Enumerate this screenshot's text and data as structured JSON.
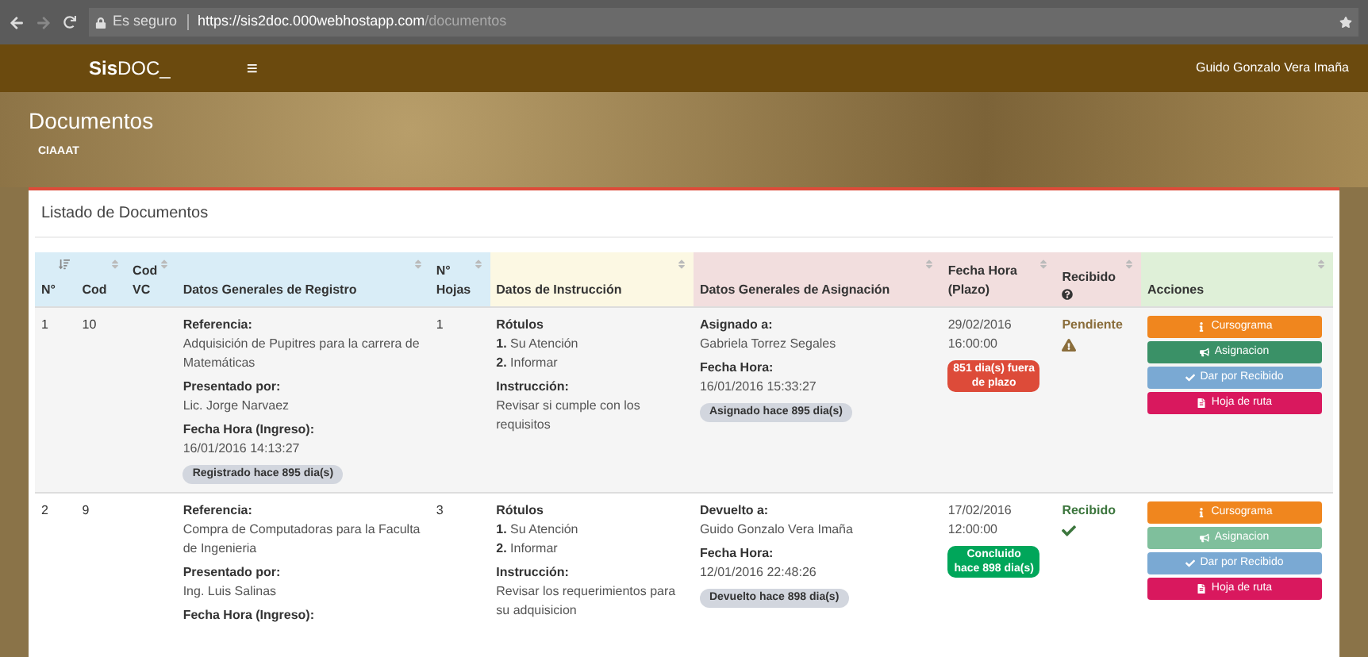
{
  "browser": {
    "security": "Es seguro",
    "url_host": "https://sis2doc.000webhostapp.com",
    "url_path": "/documentos"
  },
  "navbar": {
    "brand_bold": "Sis",
    "brand_rest": "DOC_",
    "menu_icon": "≡",
    "user": "Guido Gonzalo Vera Imaña"
  },
  "header": {
    "title": "Documentos",
    "subtitle": "CIAAAT"
  },
  "panel": {
    "title": "Listado de Documentos"
  },
  "table": {
    "columns": [
      {
        "label": "N°",
        "color": "#d9edf7"
      },
      {
        "label": "Cod",
        "color": "#d9edf7"
      },
      {
        "label": "Cod VC",
        "color": "#d9edf7"
      },
      {
        "label": "Datos Generales de Registro",
        "color": "#d9edf7"
      },
      {
        "label": "N° Hojas",
        "color": "#d9edf7"
      },
      {
        "label": "Datos de Instrucción",
        "color": "#fcf8e3"
      },
      {
        "label": "Datos Generales de Asignación",
        "color": "#f2dede"
      },
      {
        "label": "Fecha Hora (Plazo)",
        "color": "#f2dede"
      },
      {
        "label": "Recibido",
        "color": "#f2dede"
      },
      {
        "label": "Acciones",
        "color": "#dff0d8"
      }
    ],
    "rows": [
      {
        "n": "1",
        "cod": "10",
        "registro": [
          {
            "label": "Referencia:",
            "value": "Adquisición de Pupitres para la carrera de Matemáticas"
          },
          {
            "label": "Presentado por:",
            "value": "Lic. Jorge Narvaez"
          },
          {
            "label": "Fecha Hora (Ingreso):",
            "value": "16/01/2016 14:13:27"
          }
        ],
        "registro_badge": "Registrado hace 895 dia(s)",
        "hojas": "1",
        "rotulos_label": "Rótulos",
        "rotulos": [
          {
            "num": "1.",
            "text": "Su Atención"
          },
          {
            "num": "2.",
            "text": "Informar"
          }
        ],
        "instruccion_label": "Instrucción:",
        "instruccion": "Revisar si cumple con los requisitos",
        "asignacion": [
          {
            "label": "Asignado a:",
            "value": "Gabriela Torrez Segales"
          },
          {
            "label": "Fecha Hora:",
            "value": "16/01/2016 15:33:27"
          }
        ],
        "asignacion_badge": "Asignado hace 895 dia(s)",
        "plazo": [
          "29/02/2016",
          "16:00:00"
        ],
        "plazo_badge": {
          "kind": "late",
          "text": "851 dia(s) fuera de plazo"
        },
        "recibido": {
          "kind": "pending",
          "text": "Pendiente"
        },
        "actions": [
          {
            "kind": "cursograma",
            "text": "Cursograma",
            "disabled": false
          },
          {
            "kind": "asignacion",
            "text": "Asignacion",
            "disabled": false
          },
          {
            "kind": "recibido",
            "text": "Dar por Recibido",
            "disabled": true
          },
          {
            "kind": "hoja",
            "text": "Hoja de ruta",
            "disabled": false
          }
        ]
      },
      {
        "n": "2",
        "cod": "9",
        "registro": [
          {
            "label": "Referencia:",
            "value": "Compra de Computadoras para la Faculta de Ingenieria"
          },
          {
            "label": "Presentado por:",
            "value": "Ing. Luis Salinas"
          },
          {
            "label": "Fecha Hora (Ingreso):"
          }
        ],
        "hojas": "3",
        "rotulos_label": "Rótulos",
        "rotulos": [
          {
            "num": "1.",
            "text": "Su Atención"
          },
          {
            "num": "2.",
            "text": "Informar"
          }
        ],
        "instruccion_label": "Instrucción:",
        "instruccion": "Revisar los requerimientos para su adquisicion",
        "asignacion": [
          {
            "label": "Devuelto a:",
            "value": "Guido Gonzalo Vera Imaña"
          },
          {
            "label": "Fecha Hora:",
            "value": "12/01/2016 22:48:26"
          }
        ],
        "asignacion_badge": "Devuelto hace 898 dia(s)",
        "plazo": [
          "17/02/2016",
          "12:00:00"
        ],
        "plazo_badge": {
          "kind": "done",
          "text": "Concluido hace 898 dia(s)"
        },
        "recibido": {
          "kind": "received",
          "text": "Recibido"
        },
        "actions": [
          {
            "kind": "cursograma",
            "text": "Cursograma",
            "disabled": false
          },
          {
            "kind": "asignacion",
            "text": "Asignacion",
            "disabled": true
          },
          {
            "kind": "recibido",
            "text": "Dar por Recibido",
            "disabled": true
          },
          {
            "kind": "hoja",
            "text": "Hoja de ruta",
            "disabled": false
          }
        ]
      }
    ]
  }
}
